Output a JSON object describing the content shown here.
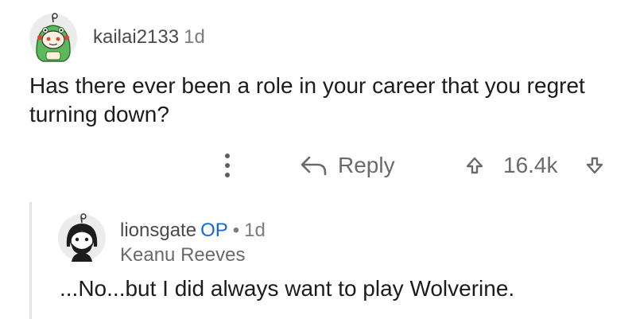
{
  "parent_comment": {
    "username": "kailai2133",
    "age": "1d",
    "text": "Has there ever been a role in your career that you regret turning down?",
    "actions": {
      "more_icon": "more-vertical-icon",
      "reply_label": "Reply",
      "reply_icon": "reply-arrow-icon",
      "score": "16.4k",
      "upvote_icon": "upvote-icon",
      "downvote_icon": "downvote-icon"
    }
  },
  "reply_comment": {
    "username": "lionsgate",
    "op_badge": "OP",
    "separator": "•",
    "age": "1d",
    "flair": "Keanu Reeves",
    "text": "...No...but I did always want to play Wolverine."
  },
  "colors": {
    "op_badge": "#0f6ad8",
    "avatar_green": "#5cb85c",
    "thread_line": "#e4e4e6",
    "muted_text": "#6a6a6c"
  }
}
